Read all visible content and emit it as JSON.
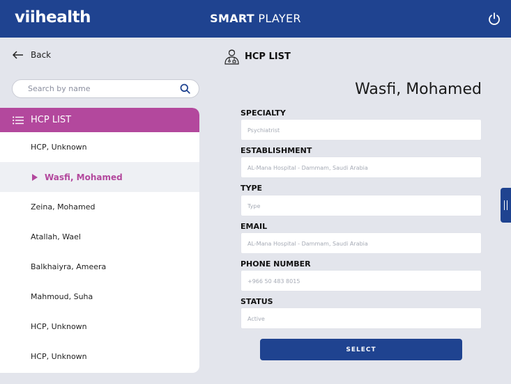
{
  "header": {
    "logo": "viihealth",
    "title_bold": "SMART",
    "title_rest": " PLAYER",
    "power_icon": "power-icon"
  },
  "nav": {
    "back_label": "Back",
    "back_icon": "arrow-left-icon"
  },
  "search": {
    "placeholder": "Search by name",
    "value": "",
    "icon": "search-icon"
  },
  "list": {
    "header": "HCP LIST",
    "header_icon": "list-icon",
    "items": [
      {
        "label": "HCP, Unknown",
        "active": false
      },
      {
        "label": "Wasfi, Mohamed",
        "active": true
      },
      {
        "label": "Zeina, Mohamed",
        "active": false
      },
      {
        "label": "Atallah, Wael",
        "active": false
      },
      {
        "label": "Balkhaiyra, Ameera",
        "active": false
      },
      {
        "label": "Mahmoud, Suha",
        "active": false
      },
      {
        "label": "HCP, Unknown",
        "active": false
      },
      {
        "label": "HCP, Unknown",
        "active": false
      }
    ]
  },
  "detail": {
    "section_title": "HCP LIST",
    "section_icon": "doctor-icon",
    "name": "Wasfi, Mohamed",
    "fields": [
      {
        "label": "SPECIALTY",
        "placeholder": "Psychiatrist"
      },
      {
        "label": "ESTABLISHMENT",
        "placeholder": "AL-Mana Hospital - Dammam, Saudi Arabia"
      },
      {
        "label": "TYPE",
        "placeholder": "Type"
      },
      {
        "label": "EMAIL",
        "placeholder": "AL-Mana Hospital - Dammam, Saudi Arabia"
      },
      {
        "label": "PHONE NUMBER",
        "placeholder": "+966 50 483 8015"
      },
      {
        "label": "STATUS",
        "placeholder": "Active"
      }
    ],
    "select_label": "SELECT"
  },
  "colors": {
    "primary": "#1f4390",
    "accent": "#b3489d",
    "background": "#e3e5ec"
  }
}
